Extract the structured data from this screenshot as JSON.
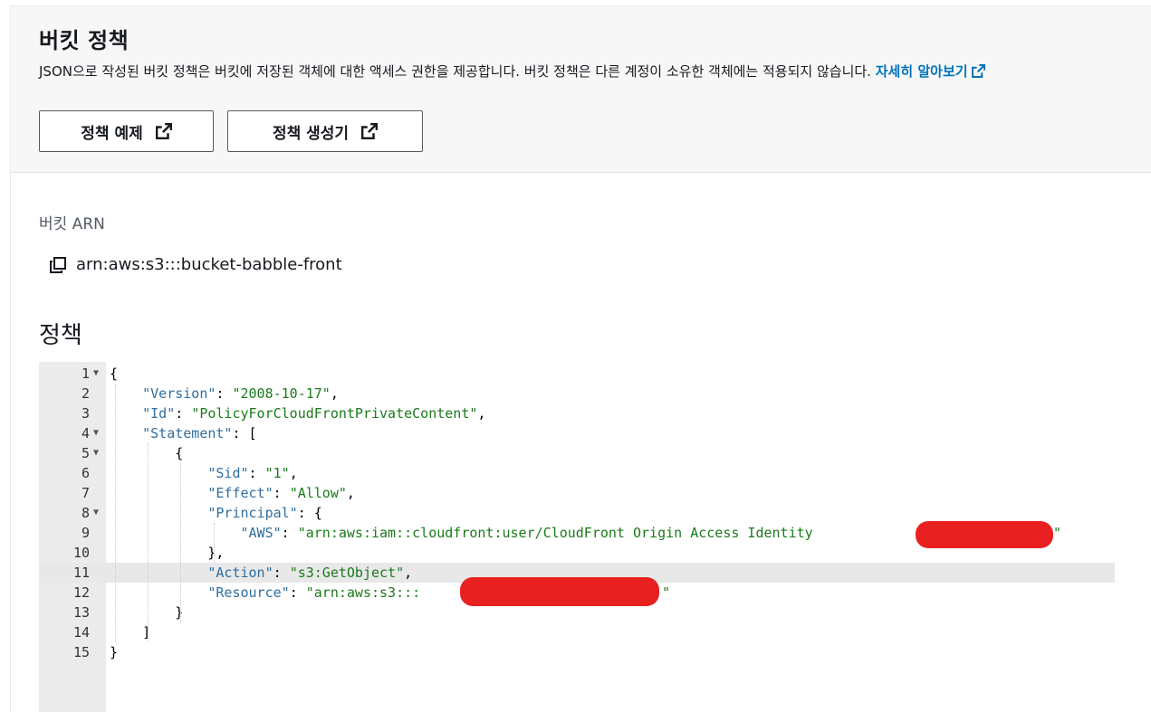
{
  "header": {
    "title": "버킷 정책",
    "description": "JSON으로 작성된 버킷 정책은 버킷에 저장된 객체에 대한 액세스 권한을 제공합니다. 버킷 정책은 다른 계정이 소유한 객체에는 적용되지 않습니다.",
    "learn_more": "자세히 알아보기",
    "btn_examples": "정책 예제",
    "btn_generator": "정책 생성기"
  },
  "arn": {
    "label": "버킷 ARN",
    "value": "arn:aws:s3:::bucket-babble-front"
  },
  "policy": {
    "title": "정책",
    "active_line": 11,
    "lines": [
      {
        "n": "1",
        "fold": true
      },
      {
        "n": "2",
        "fold": false
      },
      {
        "n": "3",
        "fold": false
      },
      {
        "n": "4",
        "fold": true
      },
      {
        "n": "5",
        "fold": true
      },
      {
        "n": "6",
        "fold": false
      },
      {
        "n": "7",
        "fold": false
      },
      {
        "n": "8",
        "fold": true
      },
      {
        "n": "9",
        "fold": false
      },
      {
        "n": "10",
        "fold": false
      },
      {
        "n": "11",
        "fold": false
      },
      {
        "n": "12",
        "fold": false
      },
      {
        "n": "13",
        "fold": false
      },
      {
        "n": "14",
        "fold": false
      },
      {
        "n": "15",
        "fold": false
      }
    ],
    "tokens": {
      "version_key": "\"Version\"",
      "version_val": "\"2008-10-17\"",
      "id_key": "\"Id\"",
      "id_val": "\"PolicyForCloudFrontPrivateContent\"",
      "statement_key": "\"Statement\"",
      "sid_key": "\"Sid\"",
      "sid_val": "\"1\"",
      "effect_key": "\"Effect\"",
      "effect_val": "\"Allow\"",
      "principal_key": "\"Principal\"",
      "aws_key": "\"AWS\"",
      "aws_val": "\"arn:aws:iam::cloudfront:user/CloudFront Origin Access Identity",
      "action_key": "\"Action\"",
      "action_val": "\"s3:GetObject\"",
      "resource_key": "\"Resource\"",
      "resource_val": "\"arn:aws:s3:::"
    }
  }
}
